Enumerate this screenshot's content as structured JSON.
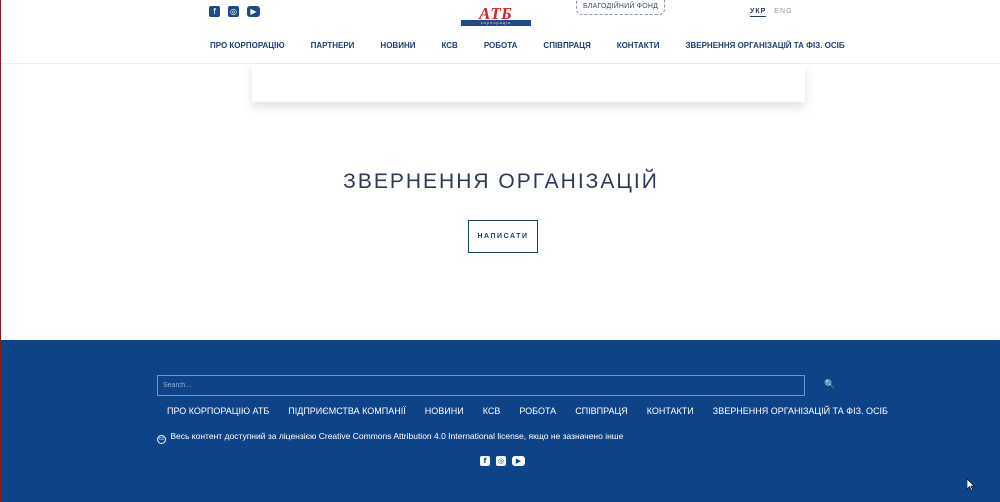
{
  "header": {
    "social": [
      {
        "icon": "facebook-icon",
        "glyph": "f"
      },
      {
        "icon": "instagram-icon",
        "glyph": "◎"
      },
      {
        "icon": "youtube-icon",
        "glyph": "▶"
      }
    ],
    "logo": {
      "word": "АТБ",
      "subline": "корпорація"
    },
    "charity_label": "БЛАГОДІЙНИЙ ФОНД",
    "languages": [
      {
        "label": "УКР",
        "active": true
      },
      {
        "label": "ENG",
        "active": false
      }
    ],
    "nav": [
      "ПРО КОРПОРАЦІЮ",
      "ПАРТНЕРИ",
      "НОВИНИ",
      "КСВ",
      "РОБОТА",
      "СПІВПРАЦЯ",
      "КОНТАКТИ",
      "ЗВЕРНЕННЯ ОРГАНІЗАЦІЙ ТА ФІЗ. ОСІБ"
    ]
  },
  "main": {
    "title": "ЗВЕРНЕННЯ ОРГАНІЗАЦІЙ",
    "write_button": "НАПИСАТИ"
  },
  "footer": {
    "search": {
      "placeholder": "Search...",
      "icon": "search-icon",
      "glyph": "🔍"
    },
    "nav": [
      "ПРО КОРПОРАЦІЮ АТБ",
      "ПІДПРИЄМСТВА КОМПАНІЇ",
      "НОВИНИ",
      "КСВ",
      "РОБОТА",
      "СПІВПРАЦЯ",
      "КОНТАКТИ",
      "ЗВЕРНЕННЯ ОРГАНІЗАЦІЙ ТА ФІЗ. ОСІБ"
    ],
    "license_icon": "cc",
    "license_text": "Весь контент доступний за ліцензією Creative Commons Attribution 4.0 International license, якщо не зазначено інше",
    "social": [
      {
        "icon": "facebook-icon",
        "glyph": "f"
      },
      {
        "icon": "instagram-icon",
        "glyph": "◎"
      },
      {
        "icon": "youtube-icon",
        "glyph": "▶"
      }
    ]
  },
  "colors": {
    "brand_blue": "#0e4387",
    "brand_red": "#e0202a",
    "text_dark": "#2b3a55"
  }
}
